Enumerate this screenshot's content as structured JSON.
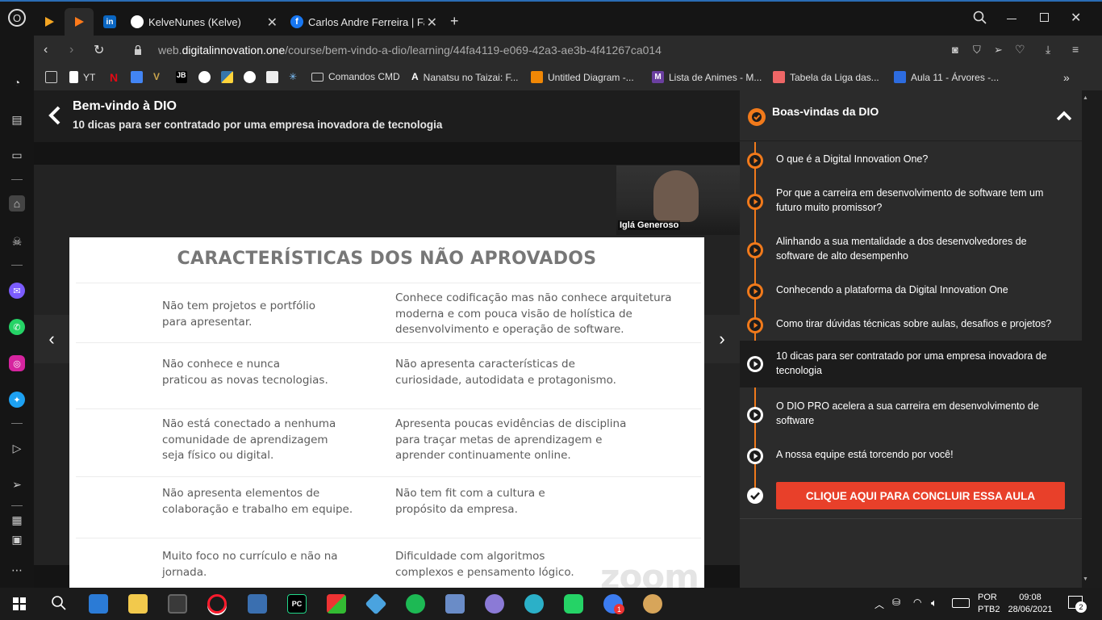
{
  "browser": {
    "tabs": [
      {
        "label": "",
        "icon": "play-icon"
      },
      {
        "label": "",
        "icon": "play-icon"
      },
      {
        "label": "",
        "icon": "linkedin-icon"
      },
      {
        "label": "KelveNunes (Kelve)",
        "icon": "github-icon"
      },
      {
        "label": "Carlos Andre Ferreira | Face",
        "icon": "facebook-icon"
      }
    ],
    "new_tab_symbol": "+",
    "url_prefix": "web.",
    "url_domain": "digitalinnovation.one",
    "url_path": "/course/bem-vindo-a-dio/learning/44fa4119-e069-42a3-ae3b-4f41267ca014",
    "bookmarks": [
      {
        "label": "YT"
      },
      {
        "label": "JB"
      },
      {
        "label": "Comandos CMD"
      },
      {
        "label": "Nanatsu no Taizai: F..."
      },
      {
        "label": "Untitled Diagram -..."
      },
      {
        "label": "Lista de Animes - M..."
      },
      {
        "label": "Tabela da Liga das..."
      },
      {
        "label": "Aula 11 - Árvores -..."
      }
    ]
  },
  "lesson": {
    "course_title": "Bem-vindo à DIO",
    "lesson_title": "10 dicas para ser contratado por uma empresa inovadora de tecnologia"
  },
  "slide": {
    "title": "CARACTERÍSTICAS DOS NÃO APROVADOS",
    "rows": [
      {
        "left": "Não tem projetos e portfólio\npara apresentar.",
        "right": "Conhece codificação mas não conhece arquitetura\nmoderna e com pouca visão de holística de\ndesenvolvimento e operação de software."
      },
      {
        "left": "Não conhece e nunca\npraticou as novas tecnologias.",
        "right": "Não apresenta características de\ncuriosidade, autodidata e protagonismo."
      },
      {
        "left": "Não está conectado a nenhuma\ncomunidade de aprendizagem\nseja físico ou digital.",
        "right": "Apresenta poucas evidências de disciplina\npara traçar metas de aprendizagem e\naprender continuamente online."
      },
      {
        "left": "Não apresenta elementos de\ncolaboração e trabalho em equipe.",
        "right": "Não tem fit com a cultura e\npropósito da empresa."
      },
      {
        "left": "Muito foco no currículo e não na\njornada.",
        "right": "Dificuldade com algoritmos\ncomplexos e pensamento lógico."
      }
    ],
    "speaker_name": "Iglá Generoso",
    "watermark": "zoom"
  },
  "panel": {
    "title": "Boas-vindas da DIO",
    "items": [
      {
        "label": "O que é a Digital Innovation One?",
        "state": "done"
      },
      {
        "label": "Por que a carreira em desenvolvimento de software tem um futuro muito promissor?",
        "state": "done"
      },
      {
        "label": "Alinhando a sua mentalidade a dos desenvolvedores de software de alto desempenho",
        "state": "done"
      },
      {
        "label": "Conhecendo a plataforma da Digital Innovation One",
        "state": "done"
      },
      {
        "label": "Como tirar dúvidas técnicas sobre aulas, desafios e projetos?",
        "state": "done"
      },
      {
        "label": "10 dicas para ser contratado por uma empresa inovadora de tecnologia",
        "state": "current"
      },
      {
        "label": "O DIO PRO acelera a sua carreira em desenvolvimento de software",
        "state": "pending"
      },
      {
        "label": "A nossa equipe está torcendo por você!",
        "state": "pending"
      }
    ],
    "complete_button": "CLIQUE AQUI PARA CONCLUIR ESSA AULA"
  },
  "taskbar": {
    "lang_line1": "POR",
    "lang_line2": "PTB2",
    "time": "09:08",
    "date": "28/06/2021",
    "notification_count": "2",
    "chrome_badge": "1"
  },
  "colors": {
    "accent": "#f17a1b",
    "button": "#e8402a",
    "opera": "#ff1b2d"
  }
}
